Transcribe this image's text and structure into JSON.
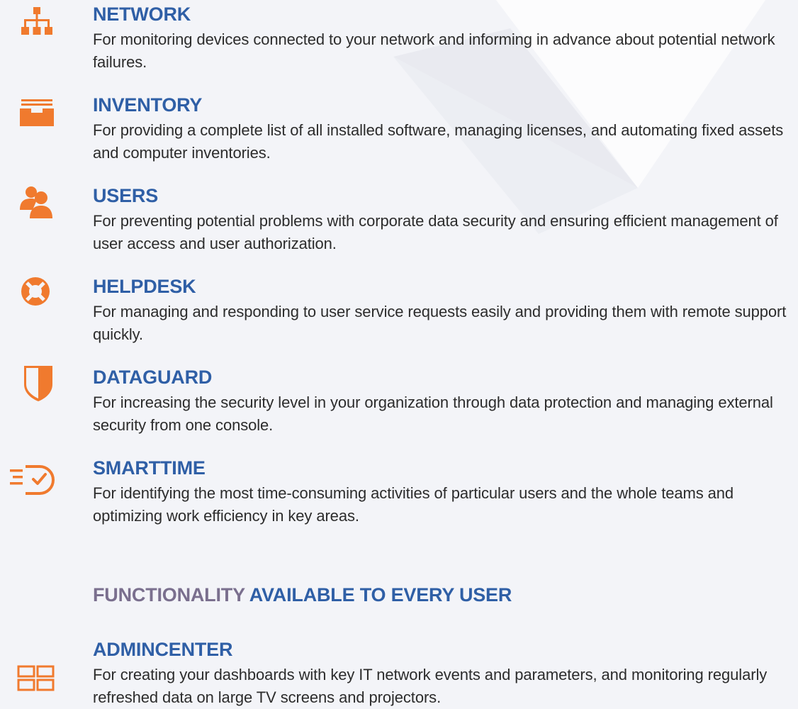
{
  "colors": {
    "accent_orange": "#f07a2e",
    "title_blue": "#2f5fa6",
    "heading_muted": "#7a6f8e",
    "body_text": "#2c2c2c",
    "background": "#f3f4f8"
  },
  "modules": [
    {
      "icon": "network-icon",
      "title": "NETWORK",
      "description": "For monitoring devices connected to your network and informing in advance about potential network failures."
    },
    {
      "icon": "inventory-icon",
      "title": "INVENTORY",
      "description": "For providing a complete list of all installed software, managing licenses, and automating fixed assets and computer inventories."
    },
    {
      "icon": "users-icon",
      "title": "USERS",
      "description": "For preventing potential problems with corporate data security and ensuring efficient management of user access and user authorization."
    },
    {
      "icon": "helpdesk-lifebuoy-icon",
      "title": "HELPDESK",
      "description": "For managing and responding to user service requests easily and providing them with remote support quickly."
    },
    {
      "icon": "dataguard-shield-icon",
      "title": "DATAGUARD",
      "description": "For increasing the security level in your organization through data protection and managing external security from one console."
    },
    {
      "icon": "smarttime-clock-icon",
      "title": "SMARTTIME",
      "description": "For identifying the most time-consuming activities of particular users and the whole teams and optimizing work efficiency in key areas."
    }
  ],
  "section": {
    "heading_part1": "FUNCTIONALITY",
    "heading_part2": "AVAILABLE TO EVERY USER"
  },
  "admincenter": {
    "icon": "admincenter-dashboard-icon",
    "title": "ADMINCENTER",
    "description": "For creating your dashboards with key IT network events and parameters, and monitoring regularly refreshed data on large TV screens and projectors."
  }
}
